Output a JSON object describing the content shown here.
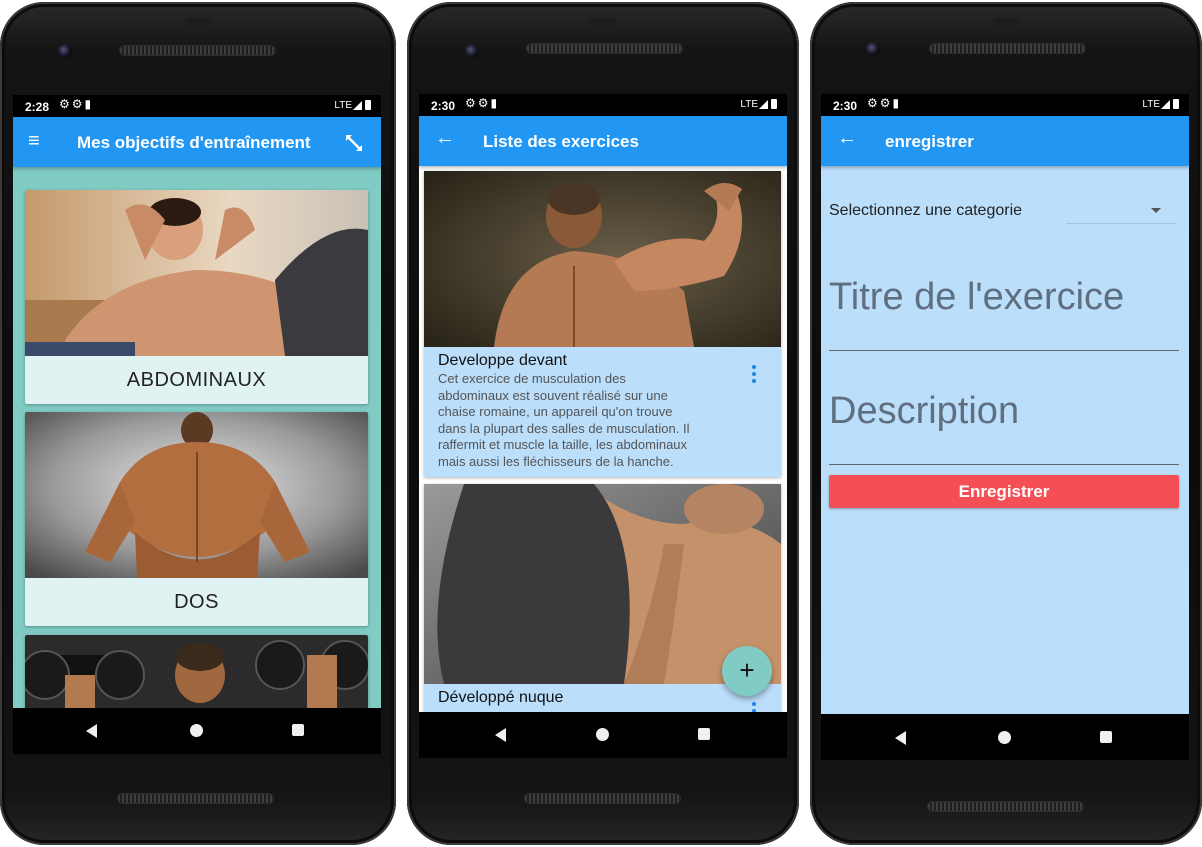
{
  "colors": {
    "appbar": "#2196f3",
    "teal_background": "#80cbc4",
    "category_card": "#e0f2f1",
    "exercise_card": "#bbdefb",
    "form_background": "#bbdefb",
    "fab": "#80cbc4",
    "save_button": "#f44f55",
    "kebab": "#1e88e5"
  },
  "screen1": {
    "status": {
      "time": "2:28",
      "network": "LTE"
    },
    "appbar": {
      "menu_icon": "hamburger-icon",
      "title": "Mes objectifs d'entraînement",
      "action_icon": "expand-arrows-icon"
    },
    "categories": [
      {
        "label": "ABDOMINAUX"
      },
      {
        "label": "DOS"
      }
    ]
  },
  "screen2": {
    "status": {
      "time": "2:30",
      "network": "LTE"
    },
    "appbar": {
      "back_icon": "arrow-back-icon",
      "title": "Liste des exercices"
    },
    "exercises": [
      {
        "title": "Developpe devant",
        "description_lines": [
          "Cet exercice de musculation des",
          "abdominaux est souvent réalisé sur une",
          "chaise romaine, un appareil qu'on trouve",
          "dans la plupart des salles de musculation. Il",
          "raffermit et muscle la taille, les abdominaux",
          "mais aussi les fléchisseurs de la hanche."
        ]
      },
      {
        "title": "Développé nuque"
      }
    ],
    "fab": {
      "label": "+"
    }
  },
  "screen3": {
    "status": {
      "time": "2:30",
      "network": "LTE"
    },
    "appbar": {
      "back_icon": "arrow-back-icon",
      "title": "enregistrer"
    },
    "category_dropdown": {
      "placeholder": "Selectionnez une categorie"
    },
    "title_field": {
      "placeholder": "Titre de l'exercice"
    },
    "description_field": {
      "placeholder": "Description"
    },
    "save_button": {
      "label": "Enregistrer"
    }
  }
}
